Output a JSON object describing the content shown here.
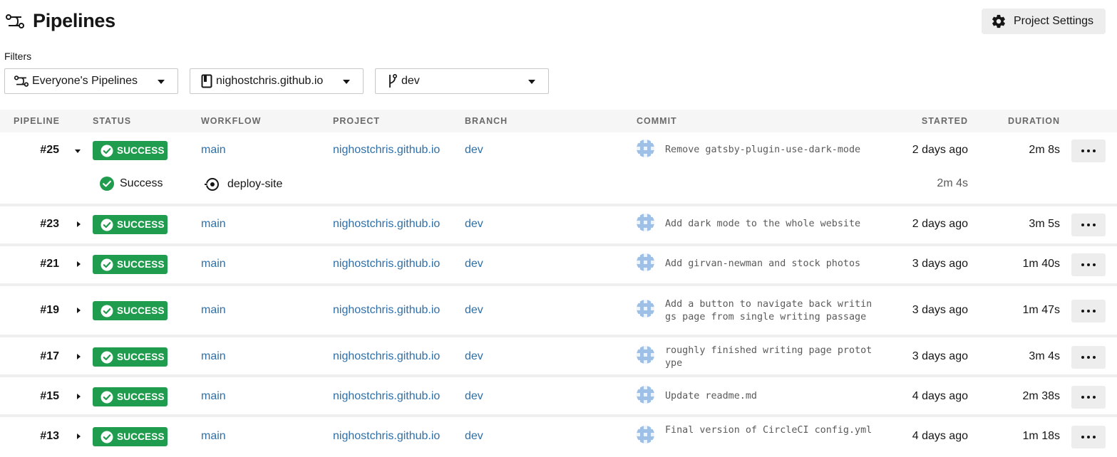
{
  "header": {
    "title": "Pipelines",
    "settings_label": "Project Settings"
  },
  "filters": {
    "label": "Filters",
    "pipelines": "Everyone's Pipelines",
    "project": "nighostchris.github.io",
    "branch": "dev"
  },
  "table": {
    "columns": [
      "PIPELINE",
      "STATUS",
      "WORKFLOW",
      "PROJECT",
      "BRANCH",
      "COMMIT",
      "STARTED",
      "DURATION"
    ],
    "rows": [
      {
        "number": "#25",
        "status": "SUCCESS",
        "workflow": "main",
        "project": "nighostchris.github.io",
        "branch": "dev",
        "commit": "Remove gatsby-plugin-use-dark-mode",
        "started": "2 days ago",
        "duration": "2m 8s",
        "expanded": true
      },
      {
        "number": "#23",
        "status": "SUCCESS",
        "workflow": "main",
        "project": "nighostchris.github.io",
        "branch": "dev",
        "commit": "Add dark mode to the whole website",
        "started": "2 days ago",
        "duration": "3m 5s"
      },
      {
        "number": "#21",
        "status": "SUCCESS",
        "workflow": "main",
        "project": "nighostchris.github.io",
        "branch": "dev",
        "commit": "Add girvan-newman and stock photos",
        "started": "3 days ago",
        "duration": "1m 40s"
      },
      {
        "number": "#19",
        "status": "SUCCESS",
        "workflow": "main",
        "project": "nighostchris.github.io",
        "branch": "dev",
        "commit": "Add a button to navigate back writings page from single writing passage",
        "started": "3 days ago",
        "duration": "1m 47s"
      },
      {
        "number": "#17",
        "status": "SUCCESS",
        "workflow": "main",
        "project": "nighostchris.github.io",
        "branch": "dev",
        "commit": "roughly finished writing page prototype",
        "started": "3 days ago",
        "duration": "3m 4s"
      },
      {
        "number": "#15",
        "status": "SUCCESS",
        "workflow": "main",
        "project": "nighostchris.github.io",
        "branch": "dev",
        "commit": "Update readme.md",
        "started": "4 days ago",
        "duration": "2m 38s"
      },
      {
        "number": "#13",
        "status": "SUCCESS",
        "workflow": "main",
        "project": "nighostchris.github.io",
        "branch": "dev",
        "commit": "Final version of CircleCI config.yml",
        "started": "4 days ago",
        "duration": "1m 18s"
      }
    ],
    "expanded_job": {
      "status": "Success",
      "name": "deploy-site",
      "duration": "2m 4s"
    }
  },
  "colors": {
    "success": "#1f9c4d",
    "link": "#2f6fa8",
    "header_bg": "#f6f6f6"
  }
}
